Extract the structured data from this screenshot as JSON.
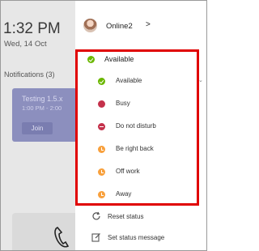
{
  "home": {
    "time": "1:32 PM",
    "date": "Wed, 14 Oct",
    "notifications_label": "Notifications (3)",
    "meeting": {
      "title": "Testing 1.5.x",
      "time": "1:00 PM - 2:00",
      "join_label": "Join"
    }
  },
  "profile": {
    "name": "Online2",
    "chevron": ">"
  },
  "current_status": {
    "label": "Available",
    "color": "#6bb700"
  },
  "status_options": [
    {
      "label": "Available",
      "icon": "available-check-icon",
      "color": "#6bb700"
    },
    {
      "label": "Busy",
      "icon": "busy-dot-icon",
      "color": "#c4314b"
    },
    {
      "label": "Do not disturb",
      "icon": "do-not-disturb-icon",
      "color": "#c4314b"
    },
    {
      "label": "Be right back",
      "icon": "clock-icon",
      "color": "#f8a03c"
    },
    {
      "label": "Off work",
      "icon": "clock-icon",
      "color": "#f8a03c"
    },
    {
      "label": "Away",
      "icon": "clock-icon",
      "color": "#f8a03c"
    }
  ],
  "actions": {
    "reset_status": "Reset status",
    "set_status_message": "Set status message"
  },
  "highlight_color": "#e00000"
}
